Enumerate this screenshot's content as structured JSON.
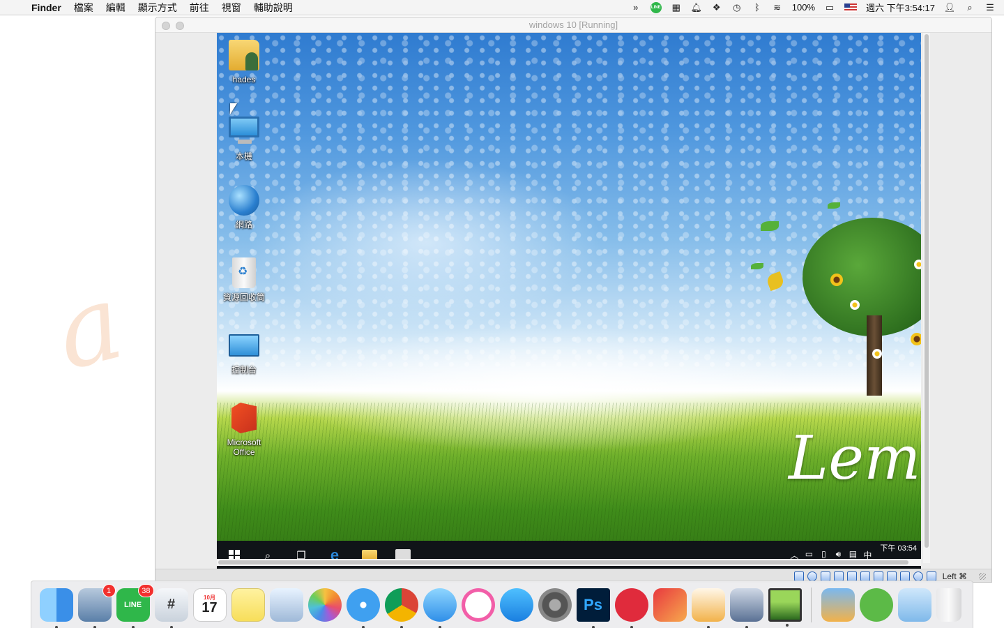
{
  "menubar": {
    "apple_glyph": "",
    "app_name": "Finder",
    "items": [
      "檔案",
      "編輯",
      "顯示方式",
      "前往",
      "視窗",
      "輔助說明"
    ],
    "status_icons": [
      "airserver-icon",
      "line-icon",
      "grid-icon",
      "bell-icon",
      "dropbox-icon",
      "time-machine-icon",
      "bluetooth-icon",
      "wifi-icon"
    ],
    "line_label": "LINE",
    "battery_text": "100%",
    "datetime": "週六 下午3:54:17"
  },
  "vm_window": {
    "title": "windows 10 [Running]",
    "host_key": "Left ⌘"
  },
  "desktop_icons": [
    {
      "label": "hades",
      "icon": "user-folder-icon"
    },
    {
      "label": "本機",
      "icon": "this-pc-icon"
    },
    {
      "label": "網路",
      "icon": "network-icon"
    },
    {
      "label": "資源回收筒",
      "icon": "recycle-bin-icon"
    },
    {
      "label": "控制台",
      "icon": "control-panel-icon"
    },
    {
      "label": "Microsoft\nOffice",
      "icon": "office-icon"
    }
  ],
  "wallpaper": {
    "brand_text": "Leme"
  },
  "win_taskbar": {
    "clock": "下午 03:54",
    "ime": "中"
  },
  "dock": {
    "items": [
      {
        "name": "finder",
        "running": true
      },
      {
        "name": "preview",
        "running": true,
        "badge": "1"
      },
      {
        "name": "line",
        "running": true,
        "badge": "38",
        "label": "LINE"
      },
      {
        "name": "slack",
        "running": true,
        "label": "#"
      },
      {
        "name": "calendar",
        "running": false,
        "label": "17",
        "month": "10月"
      },
      {
        "name": "notes",
        "running": false
      },
      {
        "name": "preview-photos",
        "running": false
      },
      {
        "name": "photos",
        "running": false
      },
      {
        "name": "safari",
        "running": true
      },
      {
        "name": "chrome",
        "running": true
      },
      {
        "name": "messages",
        "running": true
      },
      {
        "name": "itunes",
        "running": false
      },
      {
        "name": "app-store",
        "running": false
      },
      {
        "name": "system-preferences",
        "running": false
      },
      {
        "name": "photoshop",
        "running": true,
        "label": "Ps"
      },
      {
        "name": "airmail",
        "running": true
      },
      {
        "name": "books",
        "running": false
      },
      {
        "name": "pages",
        "running": true
      },
      {
        "name": "virtualbox",
        "running": true
      },
      {
        "name": "screenshot",
        "running": true
      }
    ],
    "stack_items": [
      {
        "name": "keynote"
      },
      {
        "name": "downloads-cloud"
      },
      {
        "name": "downloads-folder"
      },
      {
        "name": "trash"
      }
    ]
  },
  "colors": {
    "dock_badge": "#f2302e",
    "line_green": "#2fb74a",
    "taskbar": "#101418"
  }
}
